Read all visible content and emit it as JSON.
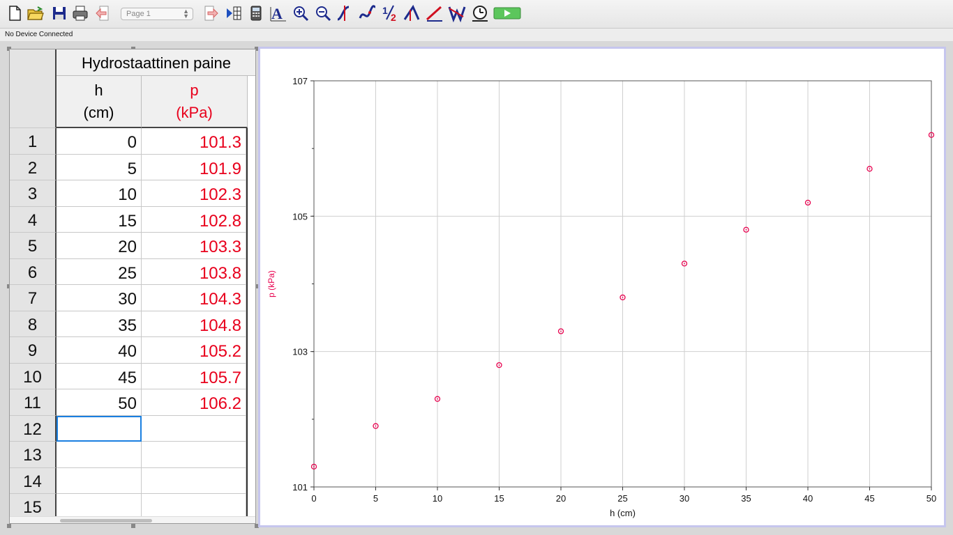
{
  "toolbar": {
    "page_select": "Page 1",
    "buttons": [
      {
        "name": "new-file-icon"
      },
      {
        "name": "open-folder-icon"
      },
      {
        "name": "save-icon"
      },
      {
        "name": "print-icon"
      },
      {
        "name": "back-page-icon"
      },
      {
        "name": "forward-page-icon"
      },
      {
        "name": "data-browser-icon"
      },
      {
        "name": "calculator-icon"
      },
      {
        "name": "autoscale-text-icon"
      },
      {
        "name": "zoom-in-icon"
      },
      {
        "name": "zoom-out-icon"
      },
      {
        "name": "examine-icon"
      },
      {
        "name": "interpolate-icon"
      },
      {
        "name": "statistics-icon"
      },
      {
        "name": "integral-icon"
      },
      {
        "name": "linear-fit-icon"
      },
      {
        "name": "curve-fit-icon"
      },
      {
        "name": "timer-icon"
      },
      {
        "name": "collect-play-icon"
      }
    ],
    "accent_play": "#5cc65c"
  },
  "status": {
    "text": "No Device Connected"
  },
  "table": {
    "dataset_title": "Hydrostaattinen paine",
    "columns": [
      {
        "name": "h",
        "unit": "(cm)",
        "color": "#111111"
      },
      {
        "name": "p",
        "unit": "(kPa)",
        "color": "#e8001c"
      }
    ],
    "row_numbers": [
      "1",
      "2",
      "3",
      "4",
      "5",
      "6",
      "7",
      "8",
      "9",
      "10",
      "11",
      "12",
      "13",
      "14",
      "15"
    ],
    "rows": [
      [
        "0",
        "101.3"
      ],
      [
        "5",
        "101.9"
      ],
      [
        "10",
        "102.3"
      ],
      [
        "15",
        "102.8"
      ],
      [
        "20",
        "103.3"
      ],
      [
        "25",
        "103.8"
      ],
      [
        "30",
        "104.3"
      ],
      [
        "35",
        "104.8"
      ],
      [
        "40",
        "105.2"
      ],
      [
        "45",
        "105.7"
      ],
      [
        "50",
        "106.2"
      ],
      [
        "",
        ""
      ],
      [
        "",
        ""
      ],
      [
        "",
        ""
      ],
      [
        "",
        ""
      ]
    ],
    "selected_cell": {
      "row": 12,
      "col": 1
    }
  },
  "chart_data": {
    "type": "scatter",
    "title": "",
    "xlabel": "h (cm)",
    "ylabel": "p (kPa)",
    "xlim": [
      0,
      50
    ],
    "ylim": [
      101,
      107
    ],
    "x_ticks": [
      "0",
      "5",
      "10",
      "15",
      "20",
      "25",
      "30",
      "35",
      "40",
      "45",
      "50"
    ],
    "y_ticks": [
      "101",
      "103",
      "105",
      "107"
    ],
    "grid": true,
    "series": [
      {
        "color": "#e8004e",
        "x": [
          0,
          5,
          10,
          15,
          20,
          25,
          30,
          35,
          40,
          45,
          50
        ],
        "y": [
          101.3,
          101.9,
          102.3,
          102.8,
          103.3,
          103.8,
          104.3,
          104.8,
          105.2,
          105.7,
          106.2
        ]
      }
    ]
  }
}
